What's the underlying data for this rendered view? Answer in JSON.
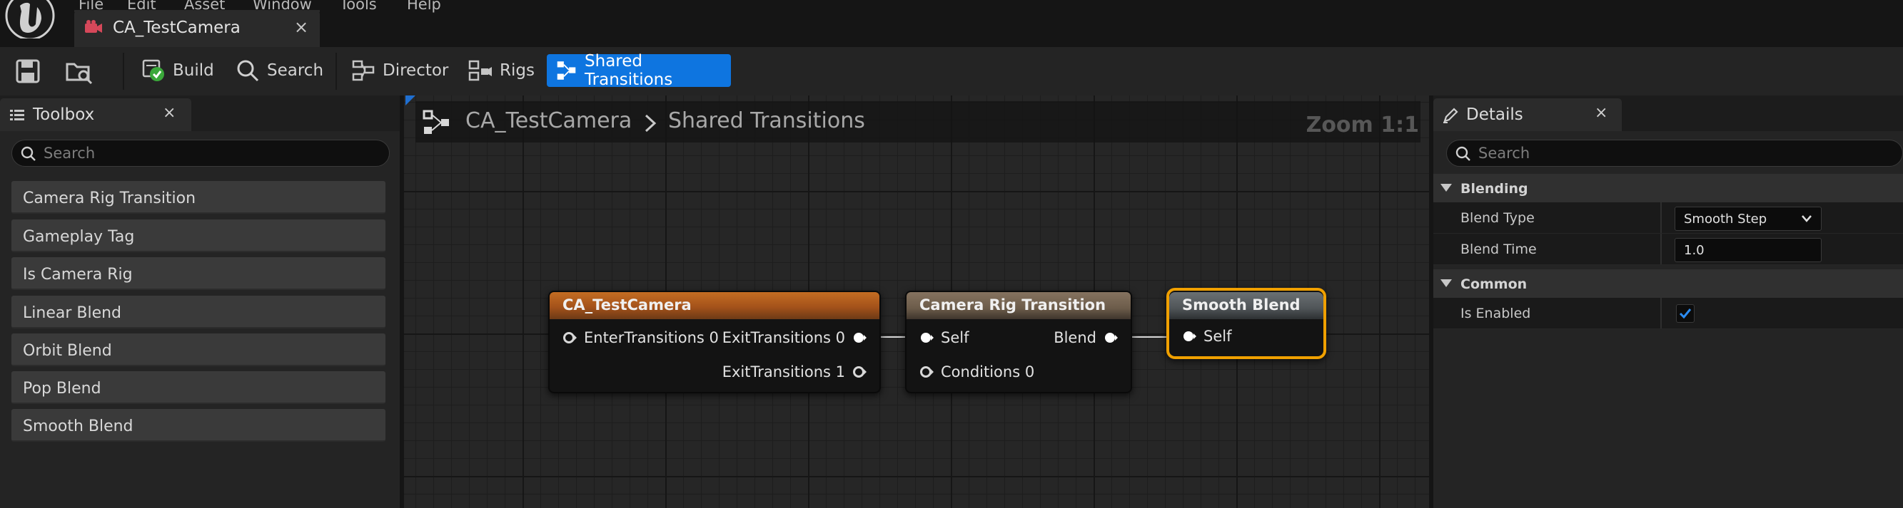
{
  "menu": {
    "items": [
      "File",
      "Edit",
      "Asset",
      "Window",
      "Tools",
      "Help"
    ]
  },
  "document_tab": {
    "title": "CA_TestCamera",
    "icon": "camera-asset-icon",
    "close_label": "×"
  },
  "toolbar": {
    "save_icon": "save-icon",
    "browse_icon": "browse-to-asset-icon",
    "buttons": [
      {
        "label": "Build",
        "icon": "build-check-icon",
        "active": false
      },
      {
        "label": "Search",
        "icon": "search-icon",
        "active": false
      },
      {
        "label": "Director",
        "icon": "director-icon",
        "active": false
      },
      {
        "label": "Rigs",
        "icon": "rigs-icon",
        "active": false
      },
      {
        "label": "Shared Transitions",
        "icon": "shared-transitions-icon",
        "active": true
      }
    ],
    "active_color": "#0e75e0"
  },
  "toolbox": {
    "title": "Toolbox",
    "close_label": "×",
    "search_placeholder": "Search",
    "items": [
      "Camera Rig Transition",
      "Gameplay Tag",
      "Is Camera Rig",
      "Linear Blend",
      "Orbit Blend",
      "Pop Blend",
      "Smooth Blend"
    ]
  },
  "graph": {
    "breadcrumb": [
      "CA_TestCamera",
      "Shared Transitions"
    ],
    "zoom": "Zoom 1:1",
    "nodes": {
      "asset": {
        "title": "CA_TestCamera",
        "header_color": "#b8601a",
        "pins": {
          "enter": "EnterTransitions 0",
          "exit0": "ExitTransitions 0",
          "exit1": "ExitTransitions 1"
        }
      },
      "rig_transition": {
        "title": "Camera Rig Transition",
        "header_color": "#7a6a58",
        "pins": {
          "self": "Self",
          "blend": "Blend",
          "conditions": "Conditions 0"
        }
      },
      "smooth_blend": {
        "title": "Smooth Blend",
        "header_color": "#5a5f62",
        "selected_color": "#f0a000",
        "pins": {
          "self": "Self"
        }
      }
    }
  },
  "details": {
    "title": "Details",
    "close_label": "×",
    "search_placeholder": "Search",
    "categories": {
      "blending": {
        "label": "Blending",
        "blend_type": {
          "name": "Blend Type",
          "value": "Smooth Step"
        },
        "blend_time": {
          "name": "Blend Time",
          "value": "1.0"
        }
      },
      "common": {
        "label": "Common",
        "is_enabled": {
          "name": "Is Enabled",
          "value": true
        }
      }
    }
  }
}
